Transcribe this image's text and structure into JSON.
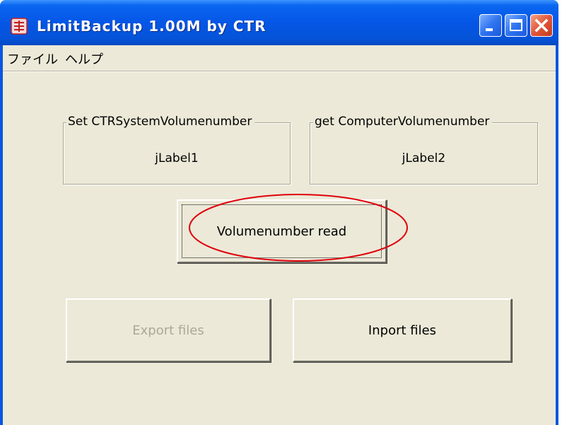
{
  "window": {
    "title": "LimitBackup 1.00M by CTR"
  },
  "menu": {
    "items": [
      "ファイル",
      "ヘルプ"
    ]
  },
  "groups": {
    "set": {
      "legend": "Set CTRSystemVolumenumber",
      "label": "jLabel1"
    },
    "get": {
      "legend": "get ComputerVolumenumber",
      "label": "jLabel2"
    }
  },
  "buttons": {
    "read": "Volumenumber read",
    "export": "Export files",
    "import": "Inport files"
  },
  "icons": {
    "app": "app-icon",
    "minimize": "minimize-icon",
    "maximize": "maximize-icon",
    "close": "close-icon"
  },
  "colors": {
    "titlebar": "#0556e6",
    "client": "#ece9d8",
    "close_button": "#e0563a",
    "annotation": "#e0000c"
  }
}
